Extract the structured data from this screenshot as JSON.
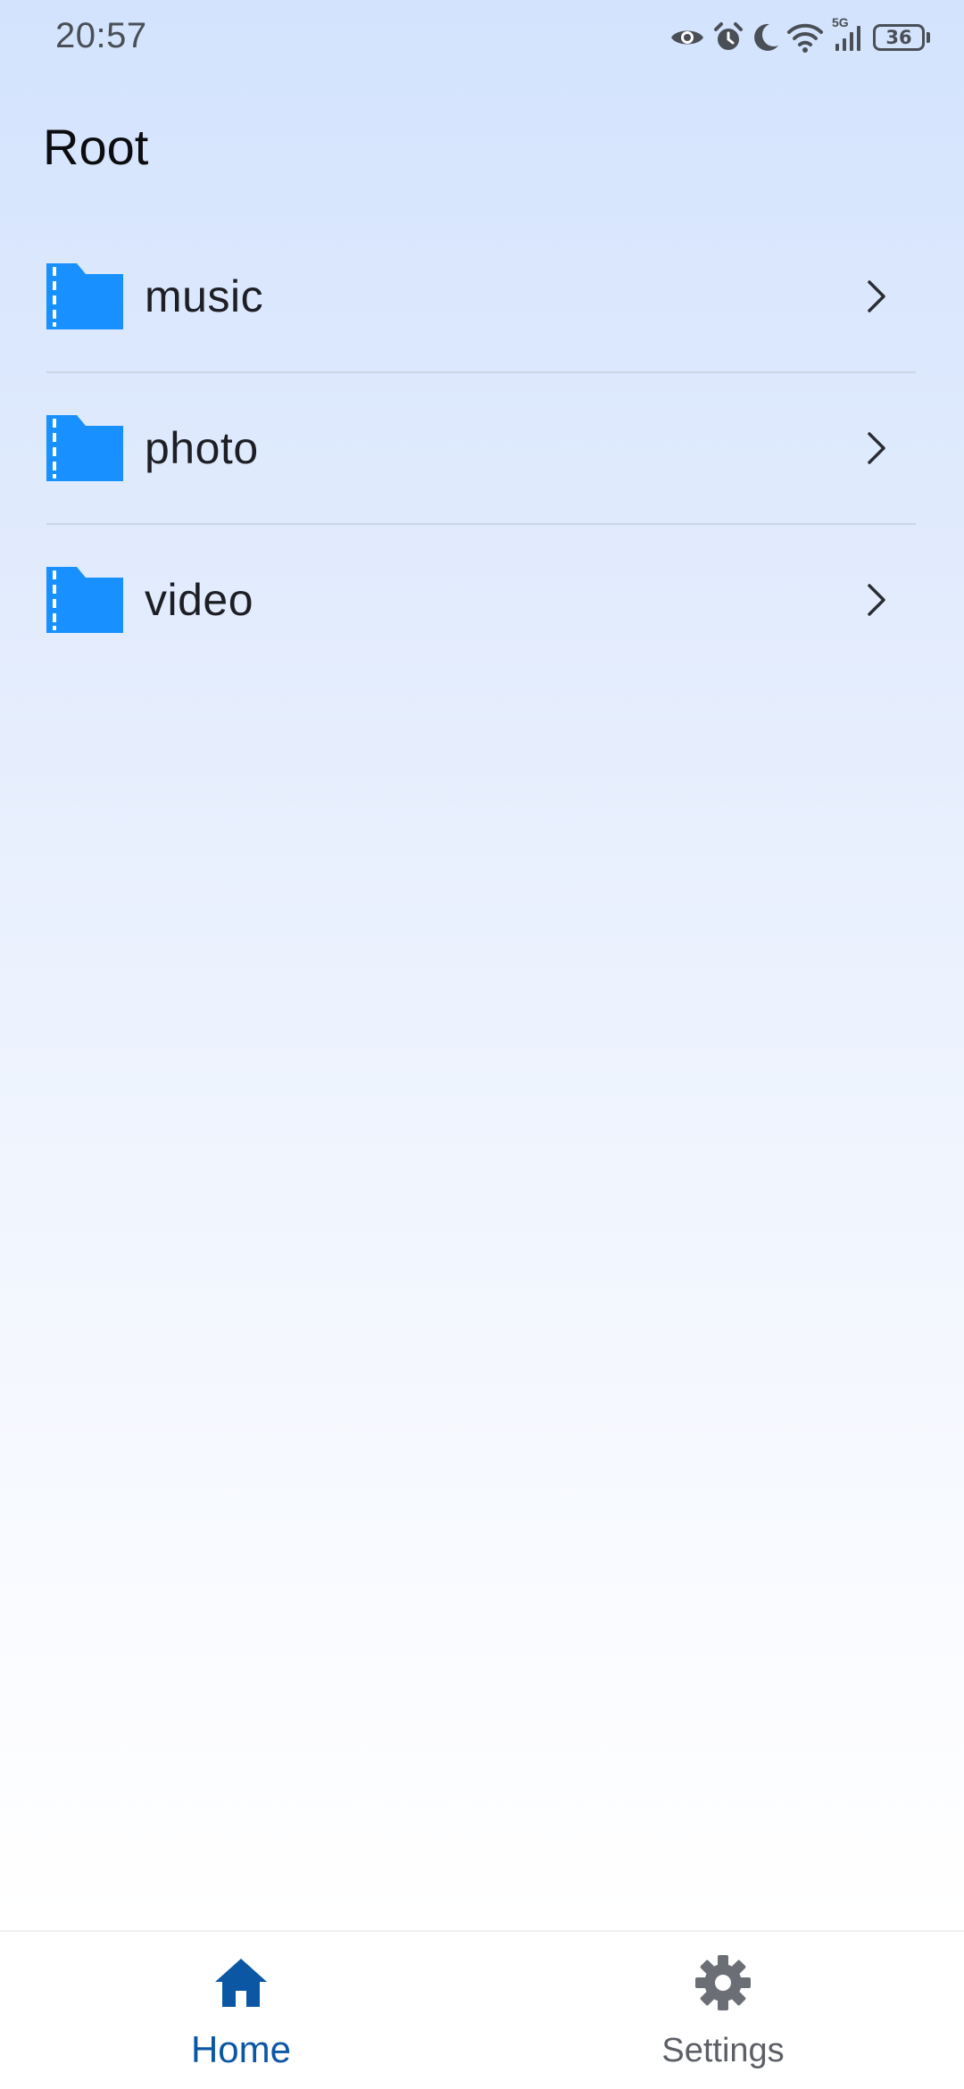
{
  "status_bar": {
    "time": "20:57",
    "network_label": "5G",
    "battery_level": "36",
    "icons": [
      "eye-icon",
      "alarm-icon",
      "moon-icon",
      "wifi-icon",
      "cellular-signal-icon",
      "battery-icon"
    ]
  },
  "page": {
    "title": "Root"
  },
  "folders": [
    {
      "label": "music",
      "icon": "folder-icon"
    },
    {
      "label": "photo",
      "icon": "folder-icon"
    },
    {
      "label": "video",
      "icon": "folder-icon"
    }
  ],
  "bottom_nav": {
    "items": [
      {
        "label": "Home",
        "icon": "home-icon",
        "active": true
      },
      {
        "label": "Settings",
        "icon": "gear-icon",
        "active": false
      }
    ]
  },
  "colors": {
    "folder": "#1890ff",
    "active_nav": "#0b57a4",
    "inactive_nav": "#5c6066",
    "background_top": "#d3e3fd",
    "background_bottom": "#ffffff"
  }
}
